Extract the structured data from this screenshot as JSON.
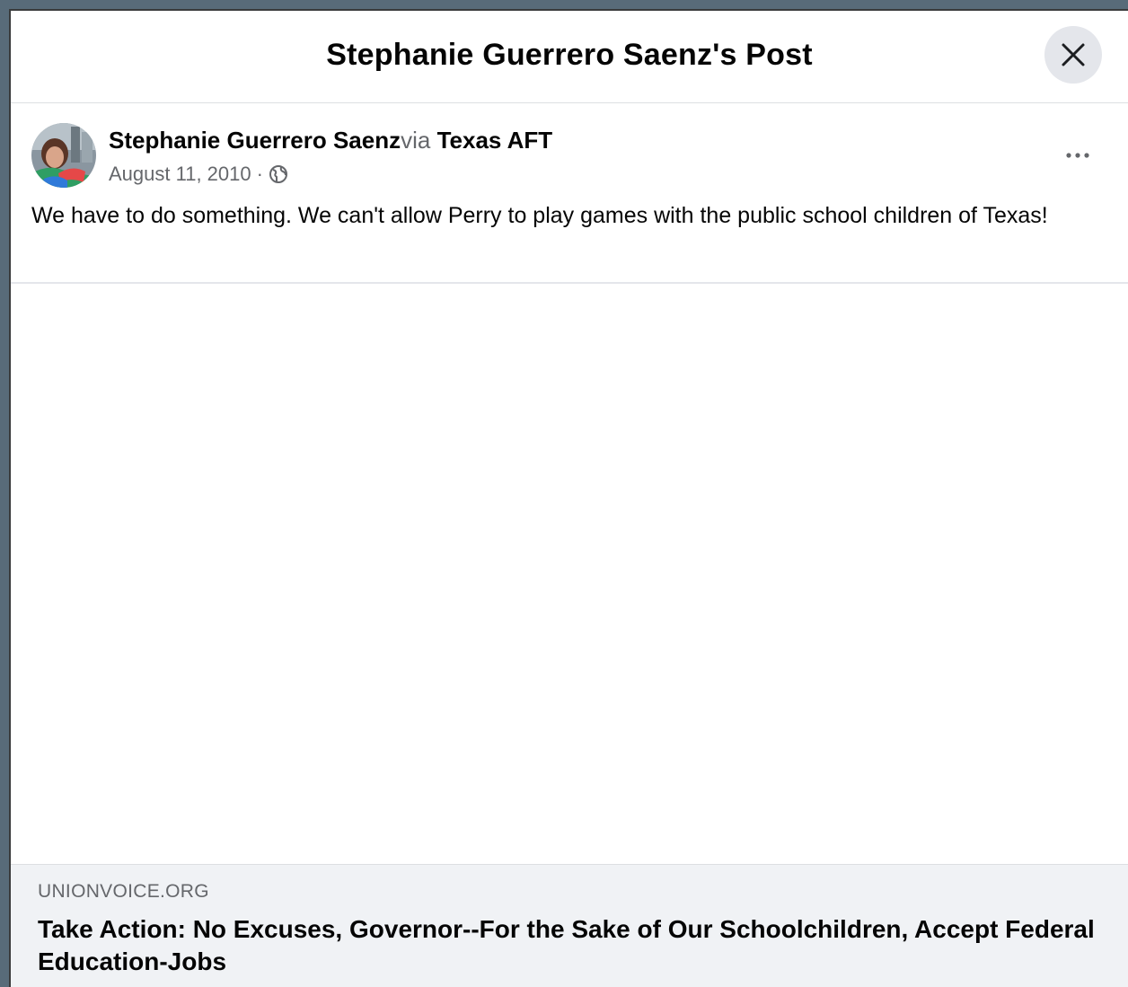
{
  "dialog": {
    "title": "Stephanie Guerrero Saenz's Post",
    "close_icon": "close-icon"
  },
  "post": {
    "author": "Stephanie Guerrero Saenz",
    "via_word": "via",
    "via_page": "Texas AFT",
    "date": "August 11, 2010",
    "separator": "·",
    "audience_icon": "globe-icon",
    "more_icon": "more-horizontal-icon",
    "text": "We have to do something. We can't allow Perry to play games with the public school children of Texas!"
  },
  "link_preview": {
    "domain": "UNIONVOICE.ORG",
    "title": "Take Action: No Excuses, Governor--For the Sake of Our Schoolchildren, Accept Federal Education-Jobs"
  },
  "colors": {
    "backdrop": "#586b79",
    "surface": "#ffffff",
    "secondary_text": "#65676b",
    "preview_bg": "#f0f2f5",
    "button_bg": "#e4e6eb"
  }
}
